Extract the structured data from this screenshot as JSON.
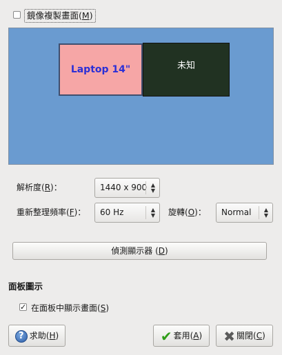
{
  "mirror": {
    "label": "鏡像複製畫面",
    "mnemonic": "M",
    "checked": false
  },
  "monitors": [
    {
      "label": "Laptop 14\"",
      "color": "#f6a6a6"
    },
    {
      "label": "未知",
      "color": "#213222"
    }
  ],
  "resolution": {
    "label": "解析度",
    "mnemonic": "R",
    "value": "1440 x 900"
  },
  "refresh": {
    "label": "重新整理頻率",
    "mnemonic": "F",
    "value": "60 Hz"
  },
  "rotation": {
    "label": "旋轉",
    "mnemonic": "O",
    "value": "Normal"
  },
  "detect_button": {
    "label": "偵測顯示器",
    "mnemonic": "D"
  },
  "panel": {
    "title": "面板圖示",
    "show_label": "在面板中顯示畫面",
    "mnemonic": "S",
    "checked": true
  },
  "buttons": {
    "help": {
      "label": "求助",
      "mnemonic": "H",
      "icon": "help-icon"
    },
    "apply": {
      "label": "套用",
      "mnemonic": "A",
      "icon": "check-icon"
    },
    "close": {
      "label": "關閉",
      "mnemonic": "C",
      "icon": "close-icon"
    }
  }
}
